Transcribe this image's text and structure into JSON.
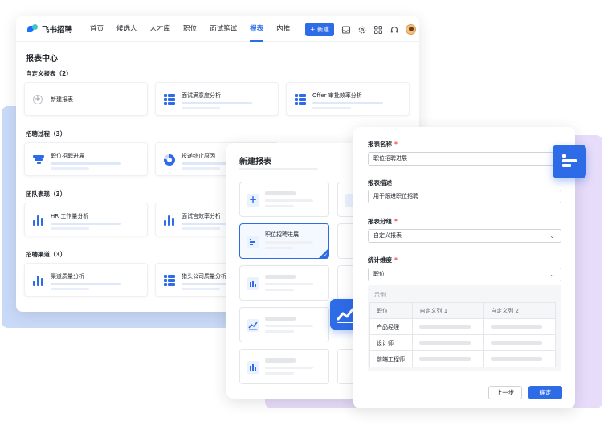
{
  "app": {
    "logo_text": "飞书招聘"
  },
  "nav": [
    "首页",
    "候选人",
    "人才库",
    "职位",
    "面试笔试",
    "报表",
    "内推"
  ],
  "new_button": "+ 新建",
  "page_title": "报表中心",
  "sections": {
    "custom": {
      "title": "自定义报表（2）",
      "cards": [
        "新建报表",
        "面试满意度分析",
        "Offer 审批效率分析"
      ]
    },
    "process": {
      "title": "招聘过程（3）",
      "cards": [
        "职位招聘进展",
        "投递终止原因"
      ]
    },
    "team": {
      "title": "团队表现（3）",
      "cards": [
        "HR 工作量分析",
        "面试官效率分析"
      ]
    },
    "channel": {
      "title": "招聘渠道（3）",
      "cards": [
        "渠道质量分析",
        "猎头公司质量分析"
      ]
    }
  },
  "new_report": {
    "title": "新建报表",
    "selected_template": "职位招聘进展"
  },
  "form": {
    "name_label": "报表名称",
    "name_value": "职位招聘进展",
    "desc_label": "报表描述",
    "desc_value": "用于跟进职位招聘",
    "group_label": "报表分组",
    "group_value": "自定义报表",
    "dimension_label": "统计维度",
    "dimension_value": "职位",
    "required_mark": "*",
    "example_label": "示例",
    "example_headers": [
      "职位",
      "自定义列 1",
      "自定义列 2"
    ],
    "example_rows": [
      "产品经理",
      "设计师",
      "前端工程师"
    ],
    "prev_button": "上一步",
    "confirm_button": "确定"
  },
  "colors": {
    "accent": "#2e6be6",
    "back_blue": "#c9daf8",
    "back_purple": "#e7dcf9"
  }
}
